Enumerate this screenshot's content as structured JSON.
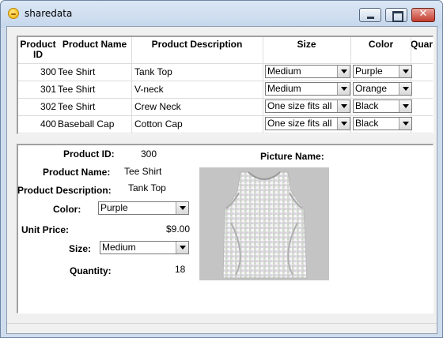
{
  "window": {
    "title": "sharedata"
  },
  "grid": {
    "headers": [
      "Product ID",
      "Product Name",
      "Product Description",
      "Size",
      "Color",
      "Quar"
    ],
    "rows": [
      {
        "id": "300",
        "name": "Tee Shirt",
        "description": "Tank Top",
        "size": "Medium",
        "color": "Purple"
      },
      {
        "id": "301",
        "name": "Tee Shirt",
        "description": "V-neck",
        "size": "Medium",
        "color": "Orange"
      },
      {
        "id": "302",
        "name": "Tee Shirt",
        "description": "Crew Neck",
        "size": "One size fits all",
        "color": "Black"
      },
      {
        "id": "400",
        "name": "Baseball Cap",
        "description": "Cotton Cap",
        "size": "One size fits all",
        "color": "Black"
      }
    ]
  },
  "detail": {
    "product_id_label": "Product ID:",
    "product_id": "300",
    "product_name_label": "Product Name:",
    "product_name": "Tee Shirt",
    "product_description_label": "Product Description:",
    "product_description": "Tank Top",
    "color_label": "Color:",
    "color": "Purple",
    "unit_price_label": "Unit Price:",
    "unit_price": "$9.00",
    "size_label": "Size:",
    "size": "Medium",
    "quantity_label": "Quantity:",
    "quantity": "18",
    "picture_name_label": "Picture Name:"
  },
  "icons": {
    "app": "app-icon",
    "dropdown": "chevron-down-icon"
  }
}
